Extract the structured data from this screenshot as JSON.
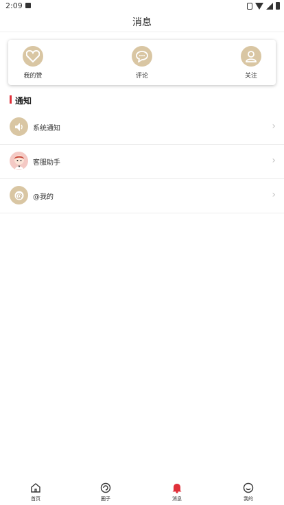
{
  "status_bar": {
    "time": "2:09"
  },
  "header": {
    "title": "消息"
  },
  "quick_actions": [
    {
      "label": "我的赞",
      "icon": "heart-icon"
    },
    {
      "label": "评论",
      "icon": "comment-icon"
    },
    {
      "label": "关注",
      "icon": "person-icon"
    }
  ],
  "section": {
    "title": "通知"
  },
  "notifications": [
    {
      "label": "系统通知",
      "icon": "speaker-icon"
    },
    {
      "label": "客服助手",
      "icon": "service-avatar-icon"
    },
    {
      "label": "@我的",
      "icon": "at-icon"
    }
  ],
  "tabbar": {
    "items": [
      {
        "label": "首页",
        "icon": "home-icon"
      },
      {
        "label": "圈子",
        "icon": "circle-icon"
      },
      {
        "label": "消息",
        "icon": "bell-icon",
        "active": true
      },
      {
        "label": "我的",
        "icon": "smile-icon"
      }
    ]
  },
  "colors": {
    "accent": "#e0303a",
    "icon_bg": "#d9c6a3",
    "active_tab": "#e0303a"
  }
}
